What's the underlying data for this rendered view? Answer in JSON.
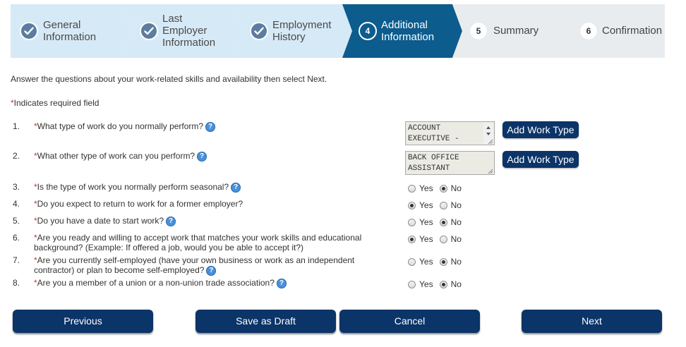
{
  "stepper": {
    "steps": [
      {
        "label_lines": [
          "General",
          "Information"
        ],
        "state": "done",
        "number": ""
      },
      {
        "label_lines": [
          "Last",
          "Employer",
          "Information"
        ],
        "state": "done",
        "number": ""
      },
      {
        "label_lines": [
          "Employment",
          "History"
        ],
        "state": "done",
        "number": ""
      },
      {
        "label_lines": [
          "Additional",
          "Information"
        ],
        "state": "active",
        "number": "4"
      },
      {
        "label_lines": [
          "Summary"
        ],
        "state": "pending",
        "number": "5"
      },
      {
        "label_lines": [
          "Confirmation"
        ],
        "state": "pending",
        "number": "6"
      }
    ],
    "colors": {
      "done_bg": "#d6e9f6",
      "active_bg": "#0c5c8e",
      "pending_bg": "#e9ecef"
    }
  },
  "intro_text": "Answer the questions about your work-related skills and availability then select Next.",
  "required_note": {
    "star": "*",
    "text": "Indicates required field"
  },
  "questions": [
    {
      "num": "1.",
      "star": "*",
      "text": "What type of work do you normally perform?",
      "help": true,
      "answer": {
        "type": "textarea",
        "value": "ACCOUNT\nEXECUTIVE -",
        "button": "Add Work Type"
      }
    },
    {
      "num": "2.",
      "star": "*",
      "text": "What other type of work can you perform?",
      "help": true,
      "answer": {
        "type": "textarea",
        "value": "BACK OFFICE\nASSISTANT",
        "button": "Add Work Type"
      }
    },
    {
      "num": "3.",
      "star": "*",
      "text": "Is the type of work you normally perform seasonal?",
      "help": true,
      "answer": {
        "type": "radio",
        "selected": "No"
      }
    },
    {
      "num": "4.",
      "star": "*",
      "text": "Do you expect to return to work for a former employer?",
      "help": false,
      "answer": {
        "type": "radio",
        "selected": "Yes"
      }
    },
    {
      "num": "5.",
      "star": "*",
      "text": "Do you have a date to start work?",
      "help": true,
      "answer": {
        "type": "radio",
        "selected": "No"
      }
    },
    {
      "num": "6.",
      "star": "*",
      "text": "Are you ready and willing to accept work that matches your work skills and educational background? (Example: If offered a job, would you be able to accept it?)",
      "help": false,
      "answer": {
        "type": "radio",
        "selected": "Yes"
      }
    },
    {
      "num": "7.",
      "star": "*",
      "text": "Are you currently self-employed (have your own business or work as an independent contractor) or plan to become self-employed?",
      "help": true,
      "answer": {
        "type": "radio",
        "selected": "No"
      }
    },
    {
      "num": "8.",
      "star": "*",
      "text": "Are you a member of a union or a non-union trade association?",
      "help": true,
      "answer": {
        "type": "radio",
        "selected": "No"
      }
    }
  ],
  "radio_labels": {
    "yes": "Yes",
    "no": "No"
  },
  "help_glyph": "?",
  "buttons": {
    "previous": "Previous",
    "save_draft": "Save as Draft",
    "cancel": "Cancel",
    "next": "Next"
  },
  "colors": {
    "button_bg": "#0b3468",
    "required_star": "#c0392b",
    "help_icon": "#4a90d9"
  }
}
